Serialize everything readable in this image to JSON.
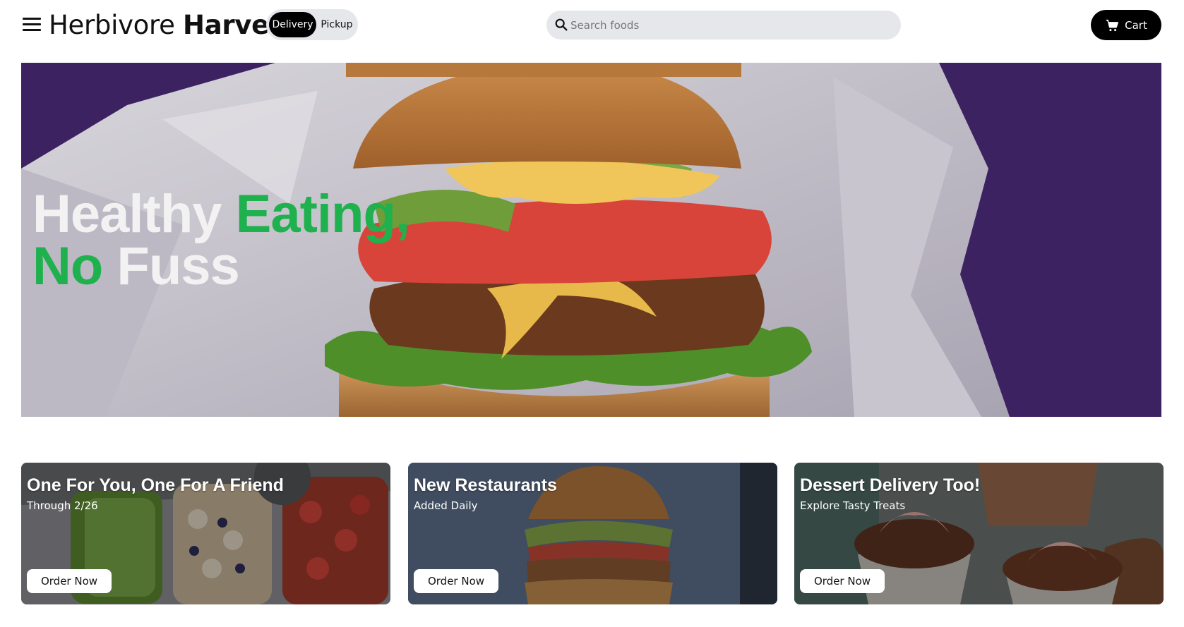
{
  "header": {
    "brand_light": "Herbivore ",
    "brand_bold": "Harvest",
    "mode_toggle": {
      "active": "Delivery",
      "inactive": "Pickup"
    },
    "search": {
      "placeholder": "Search foods",
      "value": ""
    },
    "cart_label": "Cart",
    "icons": [
      "menu-icon",
      "search-icon",
      "cart-icon"
    ]
  },
  "hero": {
    "line1_white": "Healthy ",
    "line1_green": "Eating,",
    "line2_green": "No",
    "line2_white": " Fuss",
    "colors": {
      "accent_green": "#1fb14d",
      "background_purple": "#3a1f60"
    }
  },
  "promos": [
    {
      "title": "One For You, One For A Friend",
      "subtitle": "Through 2/26",
      "button": "Order Now"
    },
    {
      "title": "New Restaurants",
      "subtitle": "Added Daily",
      "button": "Order Now"
    },
    {
      "title": "Dessert Delivery Too!",
      "subtitle": "Explore Tasty Treats",
      "button": "Order Now"
    }
  ]
}
